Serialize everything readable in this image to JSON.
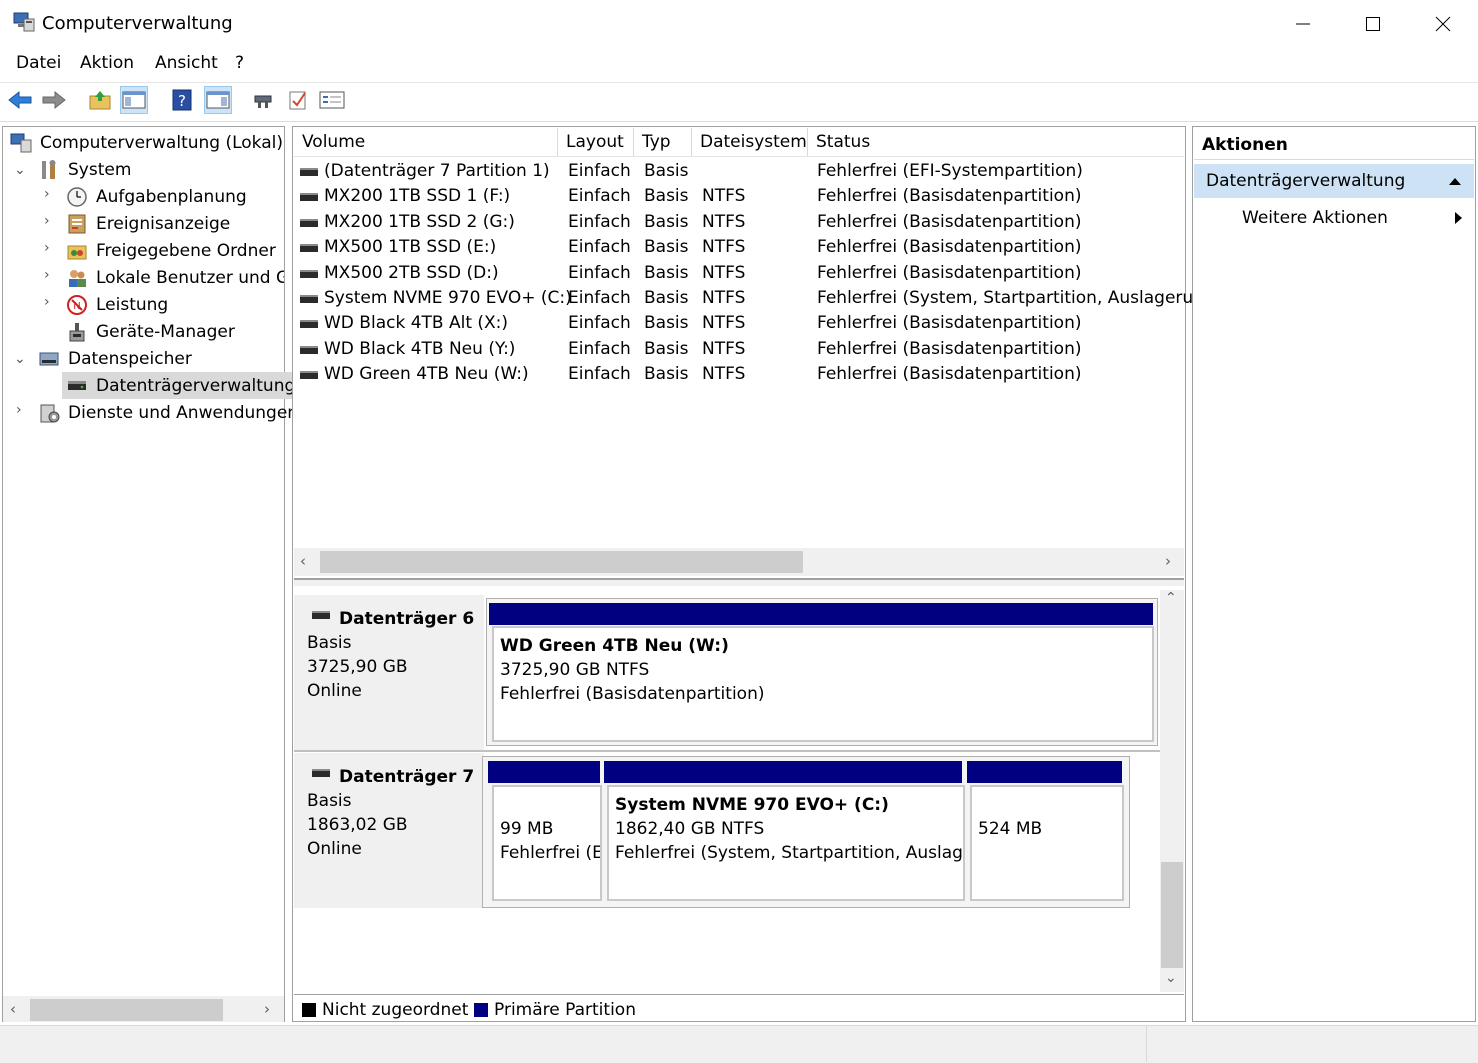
{
  "window": {
    "title": "Computerverwaltung",
    "minimize_glyph": "—",
    "maximize_glyph": "☐",
    "close_glyph": "✕"
  },
  "menu": [
    "Datei",
    "Aktion",
    "Ansicht",
    "?"
  ],
  "toolbar": {
    "icons": [
      "back-arrow-icon",
      "forward-arrow-icon",
      "folder-up-icon",
      "show-hide-tree-icon",
      "help-icon",
      "show-hide-action-pane-icon",
      "connect-icon",
      "check-icon",
      "properties-icon"
    ]
  },
  "tree": {
    "root": "Computerverwaltung (Lokal)",
    "system": "System",
    "system_children": [
      "Aufgabenplanung",
      "Ereignisanzeige",
      "Freigegebene Ordner",
      "Lokale Benutzer und Gru",
      "Leistung",
      "Geräte-Manager"
    ],
    "storage": "Datenspeicher",
    "storage_child": "Datenträgerverwaltung",
    "services": "Dienste und Anwendungen"
  },
  "volume_list": {
    "columns": [
      "Volume",
      "Layout",
      "Typ",
      "Dateisystem",
      "Status"
    ],
    "rows": [
      {
        "volume": "(Datenträger 7 Partition 1)",
        "layout": "Einfach",
        "typ": "Basis",
        "fs": "",
        "status": "Fehlerfrei (EFI-Systempartition)"
      },
      {
        "volume": "MX200 1TB SSD 1 (F:)",
        "layout": "Einfach",
        "typ": "Basis",
        "fs": "NTFS",
        "status": "Fehlerfrei (Basisdatenpartition)"
      },
      {
        "volume": "MX200 1TB SSD 2 (G:)",
        "layout": "Einfach",
        "typ": "Basis",
        "fs": "NTFS",
        "status": "Fehlerfrei (Basisdatenpartition)"
      },
      {
        "volume": "MX500 1TB SSD (E:)",
        "layout": "Einfach",
        "typ": "Basis",
        "fs": "NTFS",
        "status": "Fehlerfrei (Basisdatenpartition)"
      },
      {
        "volume": "MX500 2TB SSD (D:)",
        "layout": "Einfach",
        "typ": "Basis",
        "fs": "NTFS",
        "status": "Fehlerfrei (Basisdatenpartition)"
      },
      {
        "volume": "System NVME 970 EVO+ (C:)",
        "layout": "Einfach",
        "typ": "Basis",
        "fs": "NTFS",
        "status": "Fehlerfrei (System, Startpartition, Auslagerung"
      },
      {
        "volume": "WD Black 4TB Alt (X:)",
        "layout": "Einfach",
        "typ": "Basis",
        "fs": "NTFS",
        "status": "Fehlerfrei (Basisdatenpartition)"
      },
      {
        "volume": "WD Black 4TB Neu (Y:)",
        "layout": "Einfach",
        "typ": "Basis",
        "fs": "NTFS",
        "status": "Fehlerfrei (Basisdatenpartition)"
      },
      {
        "volume": "WD Green 4TB Neu (W:)",
        "layout": "Einfach",
        "typ": "Basis",
        "fs": "NTFS",
        "status": "Fehlerfrei (Basisdatenpartition)"
      }
    ]
  },
  "disks": [
    {
      "name": "Datenträger 6",
      "type": "Basis",
      "size": "3725,90 GB",
      "state": "Online",
      "partitions": [
        {
          "title": "WD Green 4TB Neu  (W:)",
          "line1": "3725,90 GB NTFS",
          "line2": "Fehlerfrei (Basisdatenpartition)"
        }
      ]
    },
    {
      "name": "Datenträger 7",
      "type": "Basis",
      "size": "1863,02 GB",
      "state": "Online",
      "partitions": [
        {
          "title": "",
          "line1": "99 MB",
          "line2": "Fehlerfrei (E"
        },
        {
          "title": "System NVME 970 EVO+  (C:)",
          "line1": "1862,40 GB NTFS",
          "line2": "Fehlerfrei (System, Startpartition, Auslagerungs"
        },
        {
          "title": "",
          "line1": "524 MB",
          "line2": ""
        }
      ]
    }
  ],
  "legend": {
    "unallocated": "Nicht zugeordnet",
    "unallocated_color": "#000000",
    "primary": "Primäre Partition",
    "primary_color": "#000080"
  },
  "actions": {
    "header": "Aktionen",
    "section": "Datenträgerverwaltung",
    "more": "Weitere Aktionen"
  }
}
